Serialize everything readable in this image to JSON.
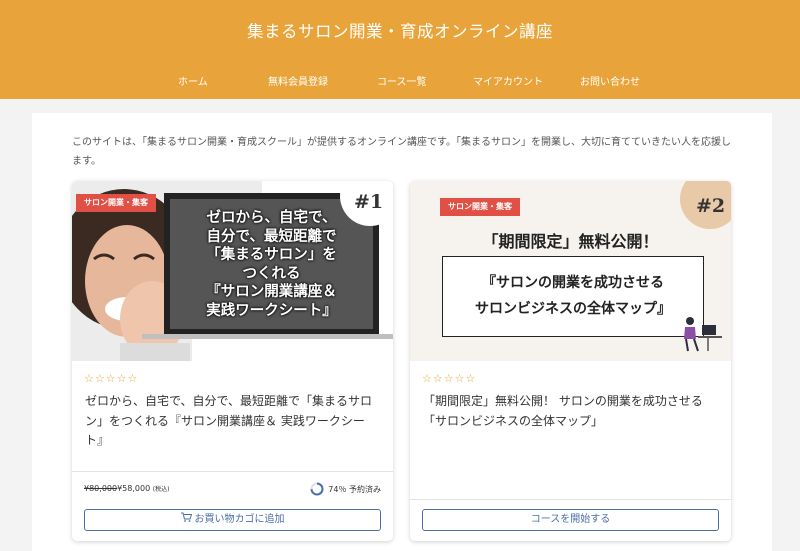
{
  "site": {
    "title": "集まるサロン開業・育成オンライン講座"
  },
  "nav": {
    "items": [
      {
        "label": "ホーム"
      },
      {
        "label": "無料会員登録"
      },
      {
        "label": "コース一覧"
      },
      {
        "label": "マイアカウント"
      },
      {
        "label": "お問い合わせ"
      }
    ]
  },
  "intro": {
    "text": "このサイトは、「集まるサロン開業・育成スクール」が提供するオンライン講座です。「集まるサロン」を開業し、大切に育てていきたい人を応援します。"
  },
  "colors": {
    "header": "#e8a43a",
    "tag": "#e05045",
    "button": "#4a6fa8",
    "star": "#e8a43a"
  },
  "courses": [
    {
      "image": {
        "tag": "サロン開業・集客",
        "badge": "#1",
        "lines": [
          "ゼロから、自宅で、",
          "自分で、最短距離で",
          "「集まるサロン」を",
          "つくれる",
          "『サロン開業講座＆",
          "実践ワークシート』"
        ]
      },
      "stars": "☆☆☆☆☆",
      "title": "ゼロから、自宅で、自分で、最短距離で「集まるサロン」をつくれる『サロン開業講座＆ 実践ワークシート』",
      "price_old": "¥80,000",
      "price_new": "¥58,000",
      "price_tax": "(税込)",
      "progress": 74,
      "progress_label": "74％ 予約済み",
      "button": "お買い物カゴに追加",
      "button_icon": "cart-icon"
    },
    {
      "image": {
        "tag": "サロン開業・集客",
        "badge": "#2",
        "headline": "「期間限定」無料公開！",
        "box_lines": [
          "『サロンの開業を成功させる",
          "サロンビジネスの全体マップ』"
        ]
      },
      "stars": "☆☆☆☆☆",
      "title": "「期間限定」無料公開！ サロンの開業を成功させる「サロンビジネスの全体マップ」",
      "button": "コースを開始する"
    }
  ]
}
